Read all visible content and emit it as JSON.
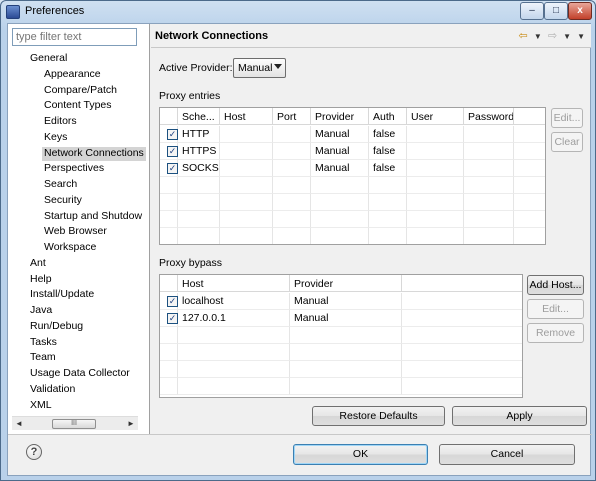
{
  "window": {
    "title": "Preferences",
    "controls": {
      "minimize": "–",
      "maximize": "□",
      "close": "x"
    }
  },
  "filter": {
    "placeholder": "type filter text"
  },
  "tree": {
    "items": [
      {
        "label": "General",
        "level": 0
      },
      {
        "label": "Appearance",
        "level": 1
      },
      {
        "label": "Compare/Patch",
        "level": 1
      },
      {
        "label": "Content Types",
        "level": 1
      },
      {
        "label": "Editors",
        "level": 1
      },
      {
        "label": "Keys",
        "level": 1
      },
      {
        "label": "Network Connections",
        "level": 1,
        "selected": true
      },
      {
        "label": "Perspectives",
        "level": 1
      },
      {
        "label": "Search",
        "level": 1
      },
      {
        "label": "Security",
        "level": 1
      },
      {
        "label": "Startup and Shutdow",
        "level": 1
      },
      {
        "label": "Web Browser",
        "level": 1
      },
      {
        "label": "Workspace",
        "level": 1
      },
      {
        "label": "Ant",
        "level": 0
      },
      {
        "label": "Help",
        "level": 0
      },
      {
        "label": "Install/Update",
        "level": 0
      },
      {
        "label": "Java",
        "level": 0
      },
      {
        "label": "Run/Debug",
        "level": 0
      },
      {
        "label": "Tasks",
        "level": 0
      },
      {
        "label": "Team",
        "level": 0
      },
      {
        "label": "Usage Data Collector",
        "level": 0
      },
      {
        "label": "Validation",
        "level": 0
      },
      {
        "label": "XML",
        "level": 0
      }
    ],
    "scroll_left": "◄",
    "scroll_right": "►",
    "scroll_thumb": "III"
  },
  "page": {
    "title": "Network Connections",
    "nav_icons": {
      "back": "⇦",
      "forward": "⇨",
      "dropdown": "▼",
      "menu": "▼"
    }
  },
  "active_provider": {
    "label": "Active Provider:",
    "value": "Manual"
  },
  "proxy_entries": {
    "label": "Proxy entries",
    "columns": [
      "Sche...",
      "Host",
      "Port",
      "Provider",
      "Auth",
      "User",
      "Password"
    ],
    "rows": [
      {
        "checked": true,
        "scheme": "HTTP",
        "host": "",
        "port": "",
        "provider": "Manual",
        "auth": "false",
        "user": "",
        "password": ""
      },
      {
        "checked": true,
        "scheme": "HTTPS",
        "host": "",
        "port": "",
        "provider": "Manual",
        "auth": "false",
        "user": "",
        "password": ""
      },
      {
        "checked": true,
        "scheme": "SOCKS",
        "host": "",
        "port": "",
        "provider": "Manual",
        "auth": "false",
        "user": "",
        "password": ""
      }
    ],
    "buttons": {
      "edit": "Edit...",
      "clear": "Clear"
    }
  },
  "proxy_bypass": {
    "label": "Proxy bypass",
    "columns": [
      "Host",
      "Provider"
    ],
    "rows": [
      {
        "checked": true,
        "host": "localhost",
        "provider": "Manual"
      },
      {
        "checked": true,
        "host": "127.0.0.1",
        "provider": "Manual"
      }
    ],
    "buttons": {
      "add_host": "Add Host...",
      "edit": "Edit...",
      "remove": "Remove"
    }
  },
  "actions": {
    "restore_defaults": "Restore Defaults",
    "apply": "Apply"
  },
  "dialog": {
    "help": "?",
    "ok": "OK",
    "cancel": "Cancel"
  },
  "check_glyph": "✓"
}
